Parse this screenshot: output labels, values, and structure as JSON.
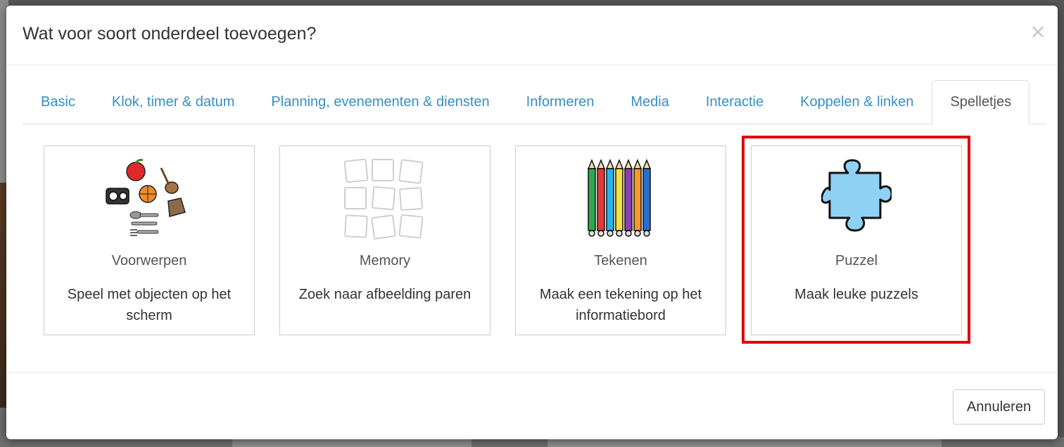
{
  "dialog": {
    "title": "Wat voor soort onderdeel toevoegen?",
    "close_icon": "×"
  },
  "tabs": [
    {
      "label": "Basic",
      "active": false
    },
    {
      "label": "Klok, timer & datum",
      "active": false
    },
    {
      "label": "Planning, evenementen & diensten",
      "active": false
    },
    {
      "label": "Informeren",
      "active": false
    },
    {
      "label": "Media",
      "active": false
    },
    {
      "label": "Interactie",
      "active": false
    },
    {
      "label": "Koppelen & linken",
      "active": false
    },
    {
      "label": "Spelletjes",
      "active": true
    }
  ],
  "cards": [
    {
      "title": "Voorwerpen",
      "description": "Speel met objecten op het scherm",
      "icon": "objects-icon"
    },
    {
      "title": "Memory",
      "description": "Zoek naar afbeelding paren",
      "icon": "memory-cards-icon"
    },
    {
      "title": "Tekenen",
      "description": "Maak een tekening op het informatiebord",
      "icon": "colored-pencils-icon"
    },
    {
      "title": "Puzzel",
      "description": "Maak leuke puzzels",
      "icon": "puzzle-piece-icon",
      "highlighted": true
    }
  ],
  "footer": {
    "cancel_label": "Annuleren"
  },
  "colors": {
    "link": "#3a8dc4",
    "highlight": "#e00000",
    "puzzle": "#8fd0f5"
  }
}
